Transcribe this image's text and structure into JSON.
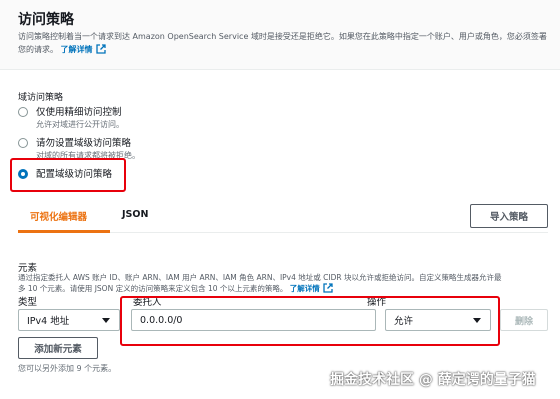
{
  "header": {
    "title": "访问策略",
    "description": "访问策略控制着当一个请求到达 Amazon OpenSearch Service 域时是接受还是拒绝它。如果您在此策略中指定一个账户、用户或角色，您必须签署您的请求。",
    "learn_more": "了解详情"
  },
  "domain_access": {
    "label": "域访问策略",
    "options": [
      {
        "label": "仅使用精细访问控制",
        "sub": "允许对域进行公开访问。",
        "checked": false
      },
      {
        "label": "请勿设置域级访问策略",
        "sub": "对域的所有请求都将被拒绝。",
        "checked": false
      },
      {
        "label": "配置域级访问策略",
        "sub": "",
        "checked": true
      }
    ]
  },
  "tabs": [
    {
      "label": "可视化编辑器",
      "active": true
    },
    {
      "label": "JSON",
      "active": false
    }
  ],
  "import_button": "导入策略",
  "elements": {
    "title": "元素",
    "desc_line1": "通过指定委托人 AWS 账户 ID、账户 ARN、IAM 用户 ARN、IAM 角色 ARN、IPv4 地址或 CIDR 块以允许或拒绝访问。自定义策略生成器允许最",
    "desc_line2": "多 10 个元素。请使用 JSON 定义的访问策略来定义包含 10 个以上元素的策略。",
    "learn_more": "了解详情",
    "col_type": "类型",
    "col_principal": "委托人",
    "col_action": "操作",
    "type_value": "IPv4 地址",
    "principal_value": "0.0.0.0/0",
    "action_value": "允许",
    "remove_button": "删除",
    "add_button": "添加新元素",
    "note": "您可以另外添加 9 个元素。"
  },
  "watermark": "掘金技术社区 @ 薛定谔的量子猫",
  "colors": {
    "accent": "#ec7211",
    "link": "#0073bb",
    "highlight": "#e8000b"
  }
}
